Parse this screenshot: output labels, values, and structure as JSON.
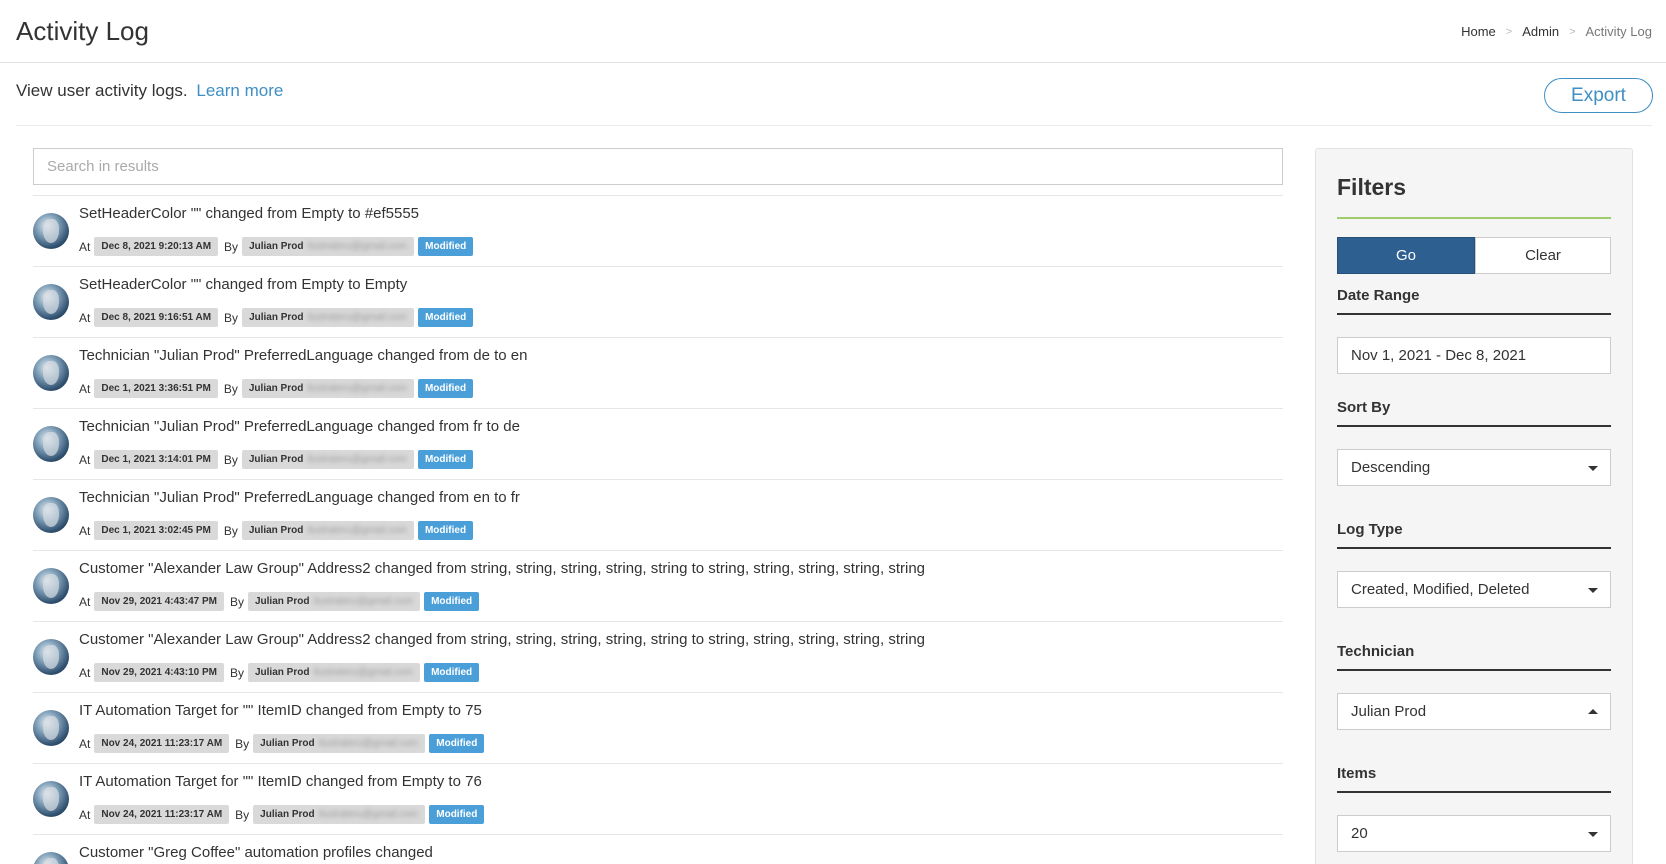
{
  "header": {
    "title": "Activity Log",
    "breadcrumb": [
      "Home",
      "Admin",
      "Activity Log"
    ]
  },
  "intro": {
    "text": "View user activity logs.",
    "link": "Learn more"
  },
  "export_label": "Export",
  "search": {
    "placeholder": "Search in results"
  },
  "labels": {
    "at": "At",
    "by": "By"
  },
  "logs": [
    {
      "message": "SetHeaderColor \"\" changed from Empty to #ef5555",
      "date": "Dec 8, 2021 9:20:13 AM",
      "user": "Julian Prod",
      "email": "ilustrateru@gmail.com",
      "status": "Modified"
    },
    {
      "message": "SetHeaderColor \"\" changed from Empty to Empty",
      "date": "Dec 8, 2021 9:16:51 AM",
      "user": "Julian Prod",
      "email": "ilustrateru@gmail.com",
      "status": "Modified"
    },
    {
      "message": "Technician \"Julian Prod\" PreferredLanguage changed from de to en",
      "date": "Dec 1, 2021 3:36:51 PM",
      "user": "Julian Prod",
      "email": "ilustrateru@gmail.com",
      "status": "Modified"
    },
    {
      "message": "Technician \"Julian Prod\" PreferredLanguage changed from fr to de",
      "date": "Dec 1, 2021 3:14:01 PM",
      "user": "Julian Prod",
      "email": "ilustrateru@gmail.com",
      "status": "Modified"
    },
    {
      "message": "Technician \"Julian Prod\" PreferredLanguage changed from en to fr",
      "date": "Dec 1, 2021 3:02:45 PM",
      "user": "Julian Prod",
      "email": "ilustrateru@gmail.com",
      "status": "Modified"
    },
    {
      "message": "Customer \"Alexander Law Group\" Address2 changed from string, string, string, string, string to string, string, string, string, string",
      "date": "Nov 29, 2021 4:43:47 PM",
      "user": "Julian Prod",
      "email": "ilustrateru@gmail.com",
      "status": "Modified"
    },
    {
      "message": "Customer \"Alexander Law Group\" Address2 changed from string, string, string, string, string to string, string, string, string, string",
      "date": "Nov 29, 2021 4:43:10 PM",
      "user": "Julian Prod",
      "email": "ilustrateru@gmail.com",
      "status": "Modified"
    },
    {
      "message": "IT Automation Target for \"\" ItemID changed from Empty to 75",
      "date": "Nov 24, 2021 11:23:17 AM",
      "user": "Julian Prod",
      "email": "ilustrateru@gmail.com",
      "status": "Modified"
    },
    {
      "message": "IT Automation Target for \"\" ItemID changed from Empty to 76",
      "date": "Nov 24, 2021 11:23:17 AM",
      "user": "Julian Prod",
      "email": "ilustrateru@gmail.com",
      "status": "Modified"
    },
    {
      "message": "Customer \"Greg Coffee\" automation profiles changed",
      "date": "",
      "user": "",
      "email": "",
      "status": ""
    }
  ],
  "filters": {
    "title": "Filters",
    "go": "Go",
    "clear": "Clear",
    "date_range": {
      "label": "Date Range",
      "value": "Nov 1, 2021 - Dec 8, 2021"
    },
    "sort_by": {
      "label": "Sort By",
      "value": "Descending"
    },
    "log_type": {
      "label": "Log Type",
      "value": "Created, Modified, Deleted"
    },
    "technician": {
      "label": "Technician",
      "value": "Julian Prod"
    },
    "items": {
      "label": "Items",
      "value": "20"
    }
  },
  "colors": {
    "accent": "#3f8fc5",
    "go_button": "#2d5f91",
    "badge": "#4a9fd9",
    "filters_rule": "#8bc34a"
  }
}
